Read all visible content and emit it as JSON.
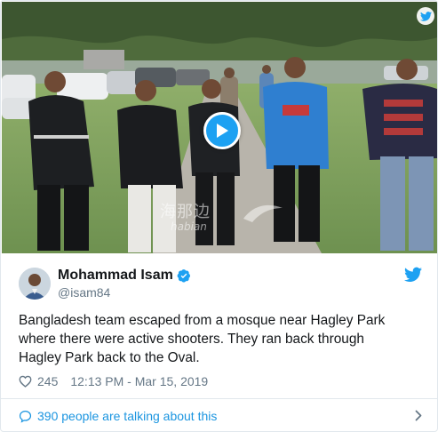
{
  "video": {
    "watermark_cn": "海那边",
    "watermark_en": "habian"
  },
  "author": {
    "display_name": "Mohammad Isam",
    "handle": "@isam84",
    "verified": true
  },
  "tweet": {
    "lines": [
      "Bangladesh team escaped from a mosque near Hagley Park",
      "where there were active shooters. They ran back through",
      "Hagley Park back to the Oval."
    ],
    "likes": "245",
    "timestamp": "12:13 PM - Mar 15, 2019"
  },
  "footer": {
    "conversation_label": "390 people are talking about this"
  },
  "colors": {
    "brand_blue": "#1da1f2",
    "link_blue": "#1b95e0",
    "muted_gray": "#657786",
    "border": "#e1e8ed"
  },
  "icons": [
    "twitter-bird-icon",
    "play-icon",
    "verified-badge-icon",
    "heart-icon",
    "speech-bubble-icon",
    "chevron-right-icon"
  ]
}
